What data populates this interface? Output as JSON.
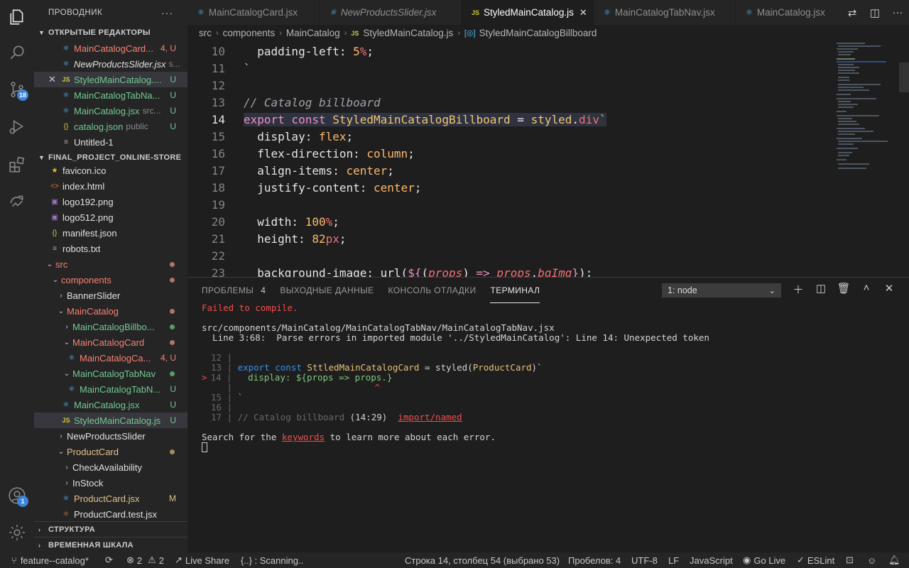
{
  "activity": {
    "scm_badge": "18",
    "account_badge": "1"
  },
  "sidebar": {
    "title": "ПРОВОДНИК",
    "more": "···",
    "open_editors": {
      "header": "ОТКРЫТЫЕ РЕДАКТОРЫ",
      "items": [
        {
          "name": "MainCatalogCard...",
          "desc": "",
          "status": "4, U"
        },
        {
          "name": "NewProductsSlider.jsx",
          "desc": "s...",
          "status": ""
        },
        {
          "name": "StyledMainCatalog....",
          "desc": "",
          "status": "U"
        },
        {
          "name": "MainCatalogTabNa...",
          "desc": "",
          "status": "U"
        },
        {
          "name": "MainCatalog.jsx",
          "desc": "src...",
          "status": "U"
        },
        {
          "name": "catalog.json",
          "desc": "public",
          "status": "U"
        },
        {
          "name": "Untitled-1",
          "desc": "",
          "status": ""
        }
      ]
    },
    "project": {
      "header": "FINAL_PROJECT_ONLINE-STORE",
      "items": [
        {
          "name": "favicon.ico",
          "status": ""
        },
        {
          "name": "index.html",
          "status": ""
        },
        {
          "name": "logo192.png",
          "status": ""
        },
        {
          "name": "logo512.png",
          "status": ""
        },
        {
          "name": "manifest.json",
          "status": ""
        },
        {
          "name": "robots.txt",
          "status": ""
        },
        {
          "name": "src",
          "status": ""
        },
        {
          "name": "components",
          "status": ""
        },
        {
          "name": "BannerSlider",
          "status": ""
        },
        {
          "name": "MainCatalog",
          "status": ""
        },
        {
          "name": "MainCatalogBillbo...",
          "status": ""
        },
        {
          "name": "MainCatalogCard",
          "status": ""
        },
        {
          "name": "MainCatalogCa...",
          "status": "4, U"
        },
        {
          "name": "MainCatalogTabNav",
          "status": ""
        },
        {
          "name": "MainCatalogTabN...",
          "status": "U"
        },
        {
          "name": "MainCatalog.jsx",
          "status": "U"
        },
        {
          "name": "StyledMainCatalog.js",
          "status": "U"
        },
        {
          "name": "NewProductsSlider",
          "status": ""
        },
        {
          "name": "ProductCard",
          "status": ""
        },
        {
          "name": "CheckAvailability",
          "status": ""
        },
        {
          "name": "InStock",
          "status": ""
        },
        {
          "name": "ProductCard.jsx",
          "status": "M"
        },
        {
          "name": "ProductCard.test.jsx",
          "status": ""
        }
      ]
    },
    "outline": "СТРУКТУРА",
    "timeline": "ВРЕМЕННАЯ ШКАЛА"
  },
  "tabs": [
    {
      "label": "MainCatalogCard.jsx",
      "active": false
    },
    {
      "label": "NewProductsSlider.jsx",
      "active": false
    },
    {
      "label": "StyledMainCatalog.js",
      "active": true
    },
    {
      "label": "MainCatalogTabNav.jsx",
      "active": false
    },
    {
      "label": "MainCatalog.jsx",
      "active": false
    }
  ],
  "breadcrumb": [
    "src",
    "components",
    "MainCatalog",
    "StyledMainCatalog.js",
    "StyledMainCatalogBillboard"
  ],
  "editor": {
    "lines": [
      {
        "n": "10",
        "text": "  padding-left: 5%;"
      },
      {
        "n": "11",
        "text": "`"
      },
      {
        "n": "12",
        "text": ""
      },
      {
        "n": "13",
        "text": "// Catalog billboard"
      },
      {
        "n": "14",
        "text": "export const StyledMainCatalogBillboard = styled.div`"
      },
      {
        "n": "15",
        "text": "  display: flex;"
      },
      {
        "n": "16",
        "text": "  flex-direction: column;"
      },
      {
        "n": "17",
        "text": "  align-items: center;"
      },
      {
        "n": "18",
        "text": "  justify-content: center;"
      },
      {
        "n": "19",
        "text": ""
      },
      {
        "n": "20",
        "text": "  width: 100%;"
      },
      {
        "n": "21",
        "text": "  height: 82px;"
      },
      {
        "n": "22",
        "text": ""
      },
      {
        "n": "23",
        "text": "  background-image: url(${(props) => props.bgImg});"
      }
    ]
  },
  "panel": {
    "tabs": [
      {
        "label": "ПРОБЛЕМЫ",
        "count": "4"
      },
      {
        "label": "ВЫХОДНЫЕ ДАННЫЕ",
        "count": ""
      },
      {
        "label": "КОНСОЛЬ ОТЛАДКИ",
        "count": ""
      },
      {
        "label": "ТЕРМИНАЛ",
        "count": ""
      }
    ],
    "terminal_select": "1: node",
    "terminal": {
      "failed": "Failed to compile.",
      "path": "src/components/MainCatalog/MainCatalogTabNav/MainCatalogTabNav.jsx",
      "error": "  Line 3:68:  Parse errors in imported module '../StyledMainCatalog': Line 14: Unexpected token",
      "ln12": "12",
      "ln13": "13",
      "code13_kw": "export const",
      "code13_name": "SttledMainCatalogCard",
      "code13_rest": "= styled(",
      "code13_arg": "ProductCard",
      "code13_end": ")`",
      "arrow": ">",
      "ln14": "14",
      "code14": "  display: ${props => props.}",
      "caret": "^",
      "ln15": "15",
      "code15": "`",
      "ln16": "16",
      "ln17": "17",
      "code17_cmt": "// Catalog billboard",
      "code17_pos": "(14:29)",
      "code17_link": "import/named",
      "search_pre": "Search for the",
      "search_link": "keywords",
      "search_post": "to learn more about each error."
    }
  },
  "status": {
    "branch": "feature--catalog*",
    "errors": "2",
    "warnings": "2",
    "live_share": "Live Share",
    "scanning": "{..} : Scanning..",
    "position": "Строка 14, столбец 54 (выбрано 53)",
    "spaces": "Пробелов: 4",
    "encoding": "UTF-8",
    "eol": "LF",
    "language": "JavaScript",
    "go_live": "Go Live",
    "eslint": "ESLint"
  },
  "colors": {
    "accent": "#3a84d9",
    "untracked": "#73c991",
    "error_file": "#f88070",
    "modified": "#e2c08d"
  }
}
